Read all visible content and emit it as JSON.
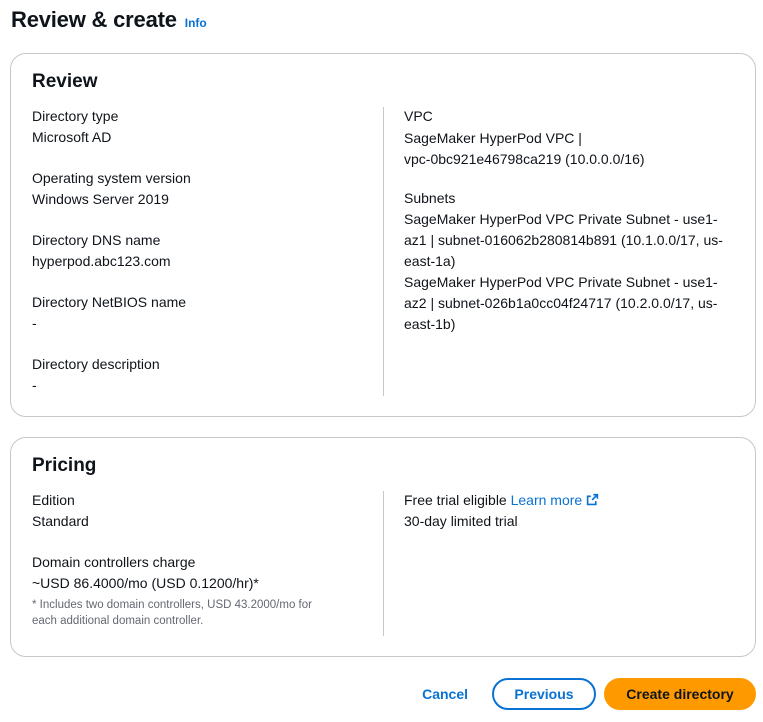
{
  "header": {
    "title": "Review & create",
    "info": "Info"
  },
  "review": {
    "title": "Review",
    "directory_type_label": "Directory type",
    "directory_type_value": "Microsoft AD",
    "os_label": "Operating system version",
    "os_value": "Windows Server 2019",
    "dns_label": "Directory DNS name",
    "dns_value": "hyperpod.abc123.com",
    "netbios_label": "Directory NetBIOS name",
    "netbios_value": "-",
    "description_label": "Directory description",
    "description_value": "-",
    "vpc_label": "VPC",
    "vpc_line1": "SageMaker HyperPod VPC |",
    "vpc_line2": "vpc-0bc921e46798ca219 (10.0.0.0/16)",
    "subnets_label": "Subnets",
    "subnet1_line1": "SageMaker HyperPod VPC Private Subnet - use1-",
    "subnet1_line2": "az1 | subnet-016062b280814b891 (10.1.0.0/17, us-",
    "subnet1_line3": "east-1a)",
    "subnet2_line1": "SageMaker HyperPod VPC Private Subnet - use1-",
    "subnet2_line2": "az2 | subnet-026b1a0cc04f24717 (10.2.0.0/17, us-",
    "subnet2_line3": "east-1b)"
  },
  "pricing": {
    "title": "Pricing",
    "edition_label": "Edition",
    "edition_value": "Standard",
    "dc_charge_label": "Domain controllers charge",
    "dc_charge_value": "~USD 86.4000/mo (USD 0.1200/hr)*",
    "footnote_line1": "* Includes two domain controllers, USD 43.2000/mo for",
    "footnote_line2": "each additional domain controller.",
    "trial_label": "Free trial eligible",
    "learn_more": "Learn more",
    "trial_value": "30-day limited trial"
  },
  "actions": {
    "cancel": "Cancel",
    "previous": "Previous",
    "create": "Create directory"
  },
  "colors": {
    "accent": "#0972d3",
    "primary_button": "#ff9900",
    "border": "#c6c6cd",
    "muted_text": "#656871"
  },
  "icons": {
    "external_link": "external-link-icon"
  }
}
